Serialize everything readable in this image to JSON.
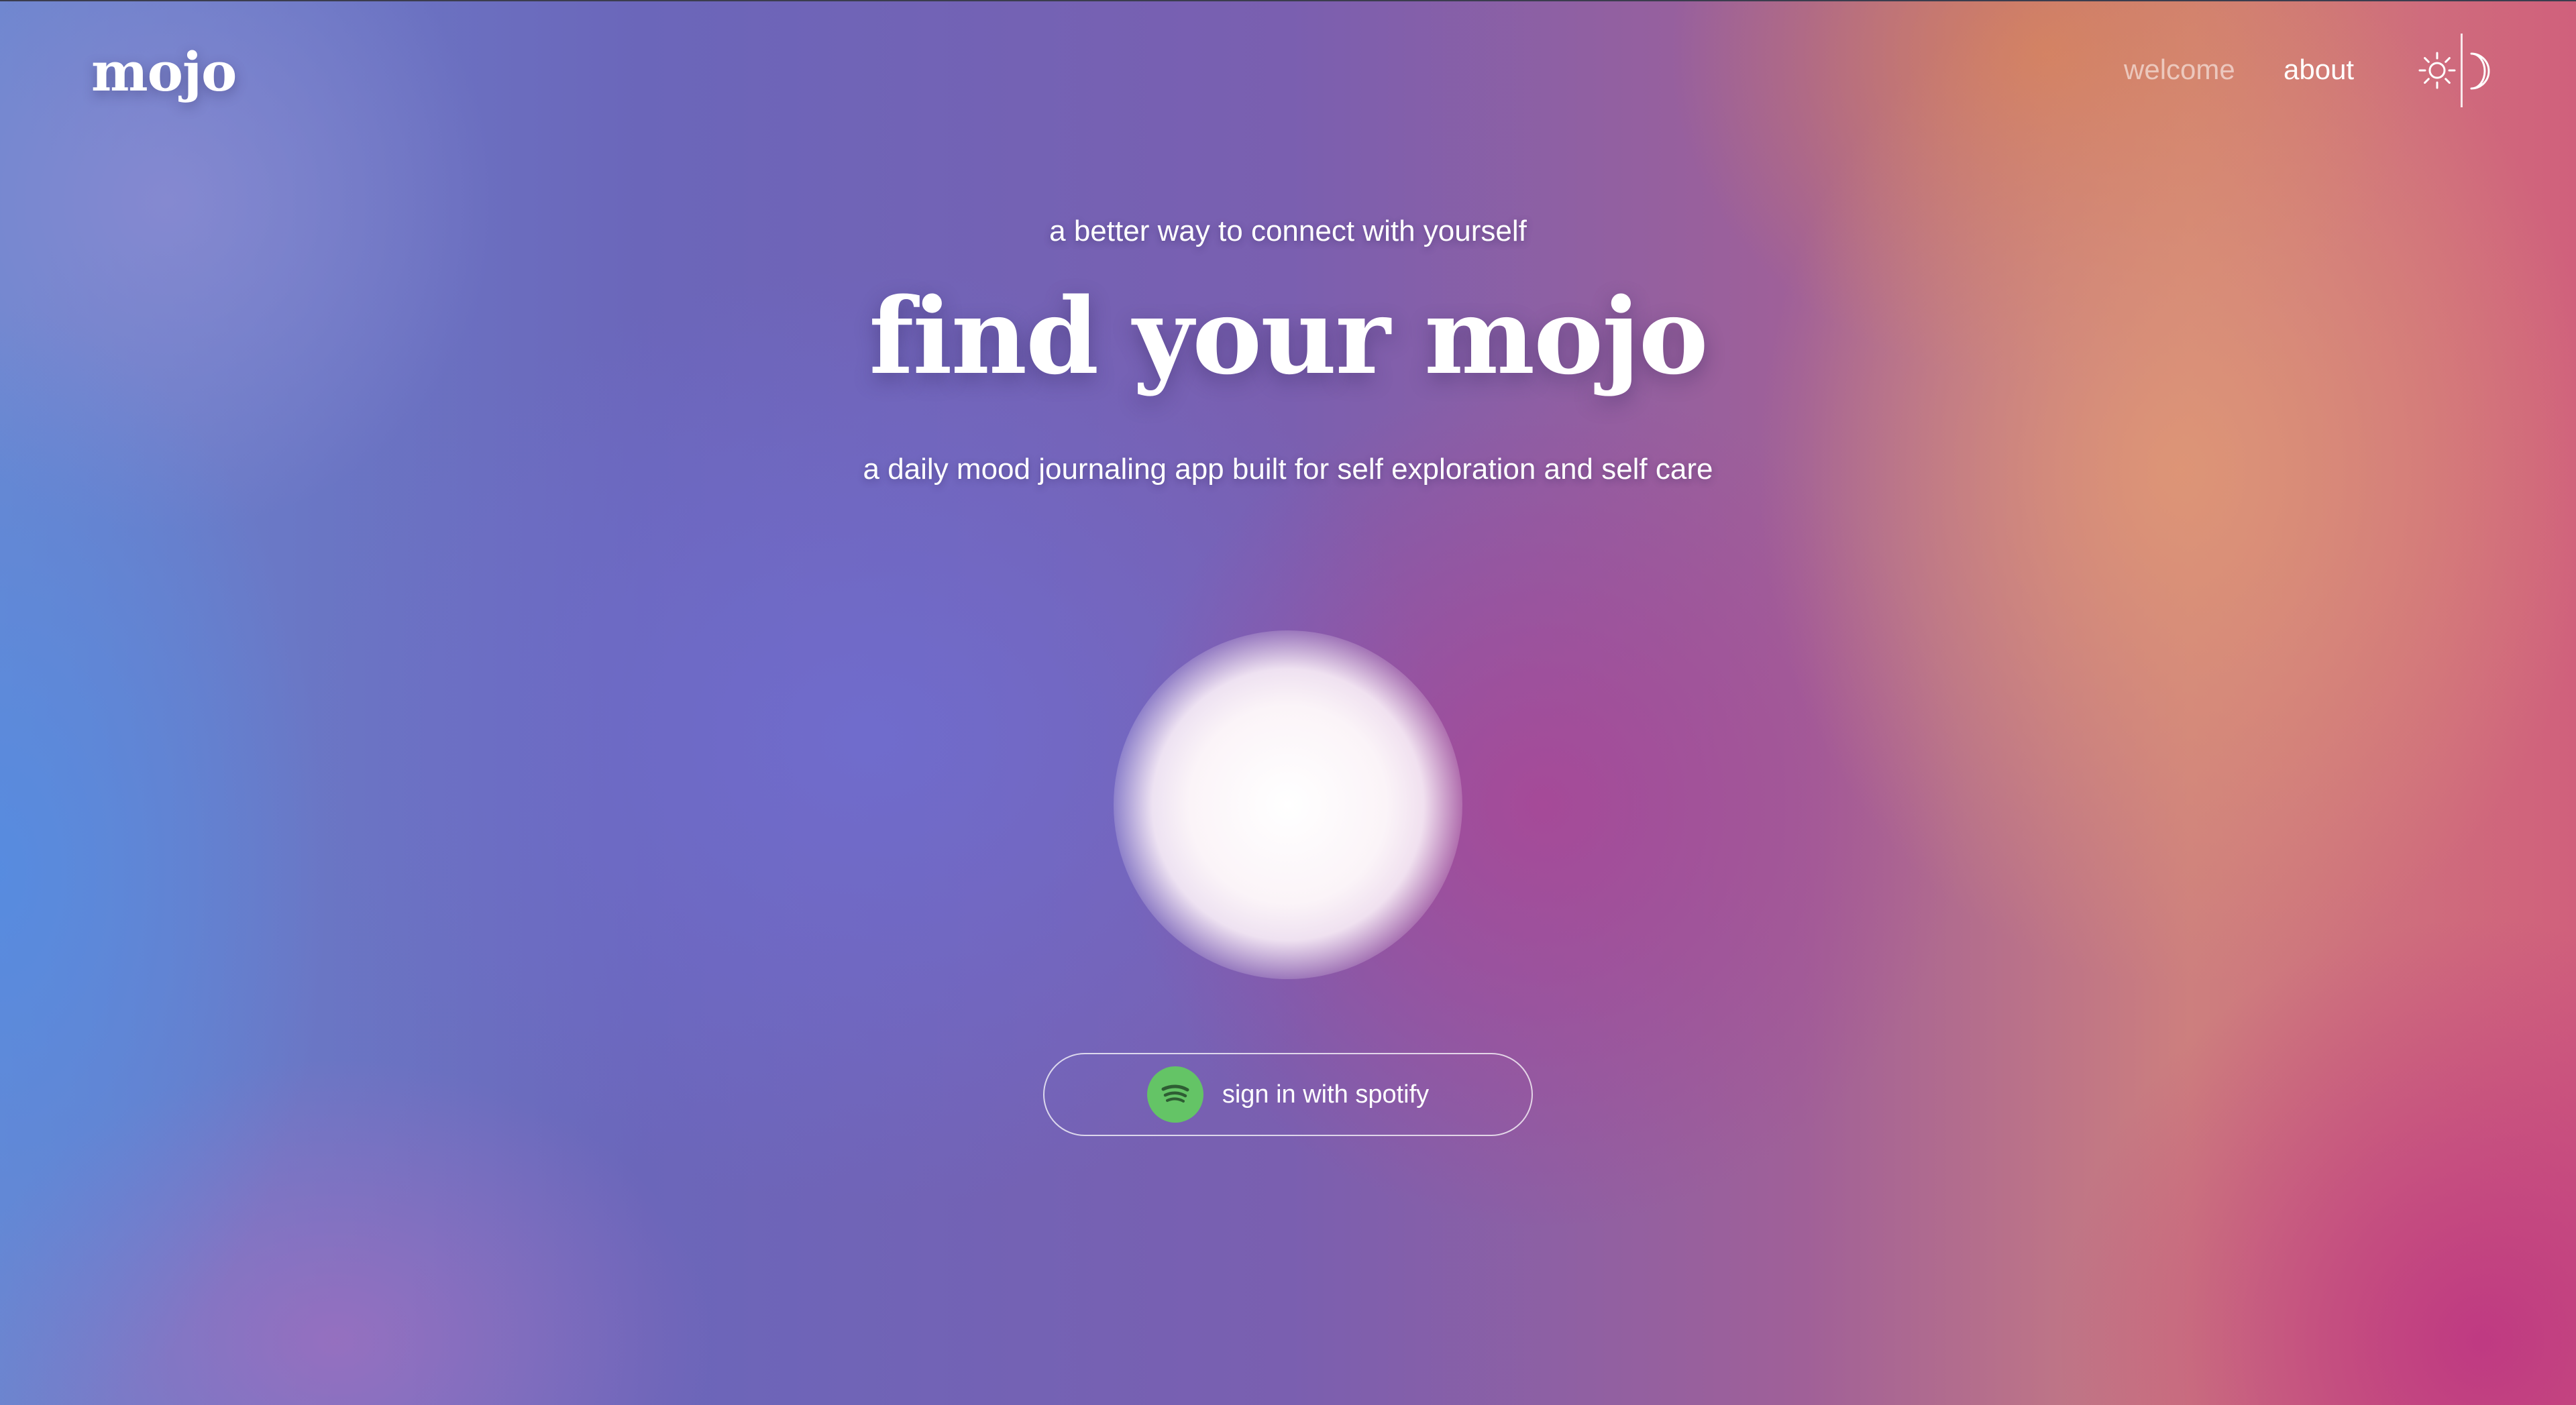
{
  "header": {
    "logo": "mojo",
    "nav": {
      "welcome": "welcome",
      "about": "about"
    },
    "theme_toggle": {
      "icons": [
        "sun-icon",
        "moon-icon"
      ]
    }
  },
  "hero": {
    "tagline": "a better way to connect with yourself",
    "headline": "find your mojo",
    "subheadline": "a daily mood journaling app built for self exploration and self care"
  },
  "signin": {
    "label": "sign in with spotify",
    "icon": "spotify-icon",
    "icon_color": "#64c466"
  },
  "colors": {
    "text": "#ffffff",
    "nav_inactive": "rgba(255,255,255,0.55)"
  }
}
